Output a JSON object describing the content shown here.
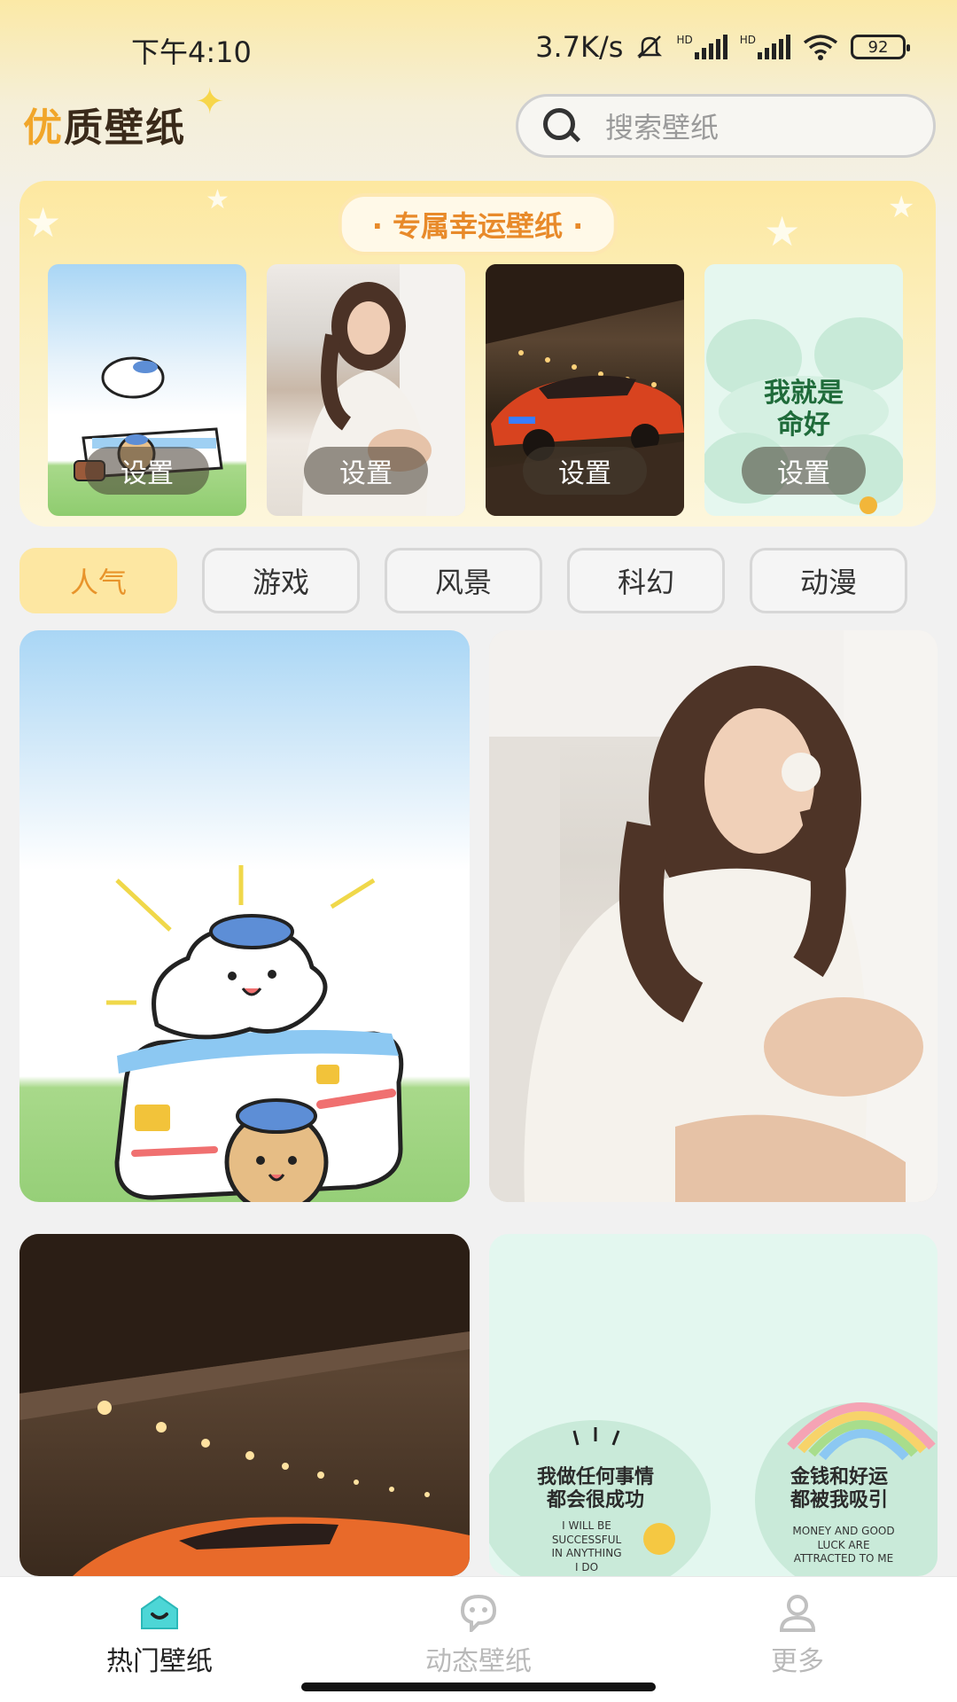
{
  "status_bar": {
    "time": "下午4:10",
    "net_speed": "3.7K/s",
    "signal_label_1": "HD",
    "signal_label_2": "HD",
    "battery": "92"
  },
  "header": {
    "logo_first": "优",
    "logo_rest": "质壁纸",
    "search_placeholder": "搜索壁纸"
  },
  "lucky": {
    "title": "· 专属幸运壁纸 ·",
    "cards": [
      {
        "art": "dog-cartoon",
        "button": "设置"
      },
      {
        "art": "girl-photo",
        "button": "设置"
      },
      {
        "art": "red-car",
        "button": "设置"
      },
      {
        "art": "quote-card",
        "button": "设置"
      }
    ]
  },
  "categories": {
    "items": [
      "人气",
      "游戏",
      "风景",
      "科幻",
      "动漫"
    ],
    "active_index": 0
  },
  "grid": {
    "quote_left": "我做任何事情\n都会很成功",
    "quote_left_en": "I WILL BE\nSUCCESSFUL\nIN ANYTHING\nI DO",
    "quote_right": "金钱和好运\n都被我吸引",
    "quote_right_en": "MONEY AND GOOD\nLUCK ARE\nATTRACTED TO ME",
    "thumb_quote_main": "我就是\n命好"
  },
  "bottom_nav": {
    "items": [
      {
        "label": "热门壁纸",
        "icon": "home-icon"
      },
      {
        "label": "动态壁纸",
        "icon": "chat-icon"
      },
      {
        "label": "更多",
        "icon": "person-icon"
      }
    ],
    "active_index": 0
  },
  "colors": {
    "accent": "#f1a62a",
    "active_tab_bg": "#fde7a2",
    "active_tab_text": "#e8942b",
    "nav_active_icon": "#4dd6d6"
  }
}
